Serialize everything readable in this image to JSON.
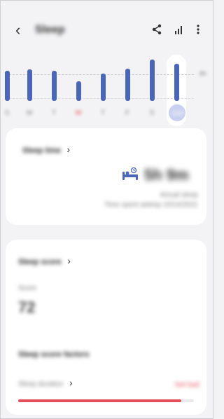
{
  "header": {
    "back_icon": "chevron-left-icon",
    "title": "Sleep",
    "share_icon": "share-icon",
    "stats_icon": "bar-chart-icon",
    "more_icon": "more-vert-icon"
  },
  "chart": {
    "days": [
      "S",
      "M",
      "T",
      "W",
      "T",
      "F",
      "S",
      "SAT"
    ],
    "values": [
      7.0,
      7.2,
      6.9,
      4.5,
      6.3,
      7.5,
      9.5,
      8.5
    ],
    "selected_index": 7,
    "y_label": "8h",
    "sunday_color": "#e24f5b",
    "bar_color": "#4a66b6"
  },
  "sleep_time_card": {
    "title": "Sleep time",
    "time": "5h 9m",
    "line1": "Actual sleep",
    "line2": "Time spent asleep 10/14/2021",
    "icon": "bed-icon"
  },
  "sleep_score_card": {
    "title": "Sleep score",
    "score_label": "Score",
    "score_value": "72",
    "factors_title": "Sleep score factors",
    "factor_label": "Sleep duration",
    "factor_value": "Not bad",
    "factor_progress": 0.93,
    "progress_color": "#e24f5b"
  }
}
